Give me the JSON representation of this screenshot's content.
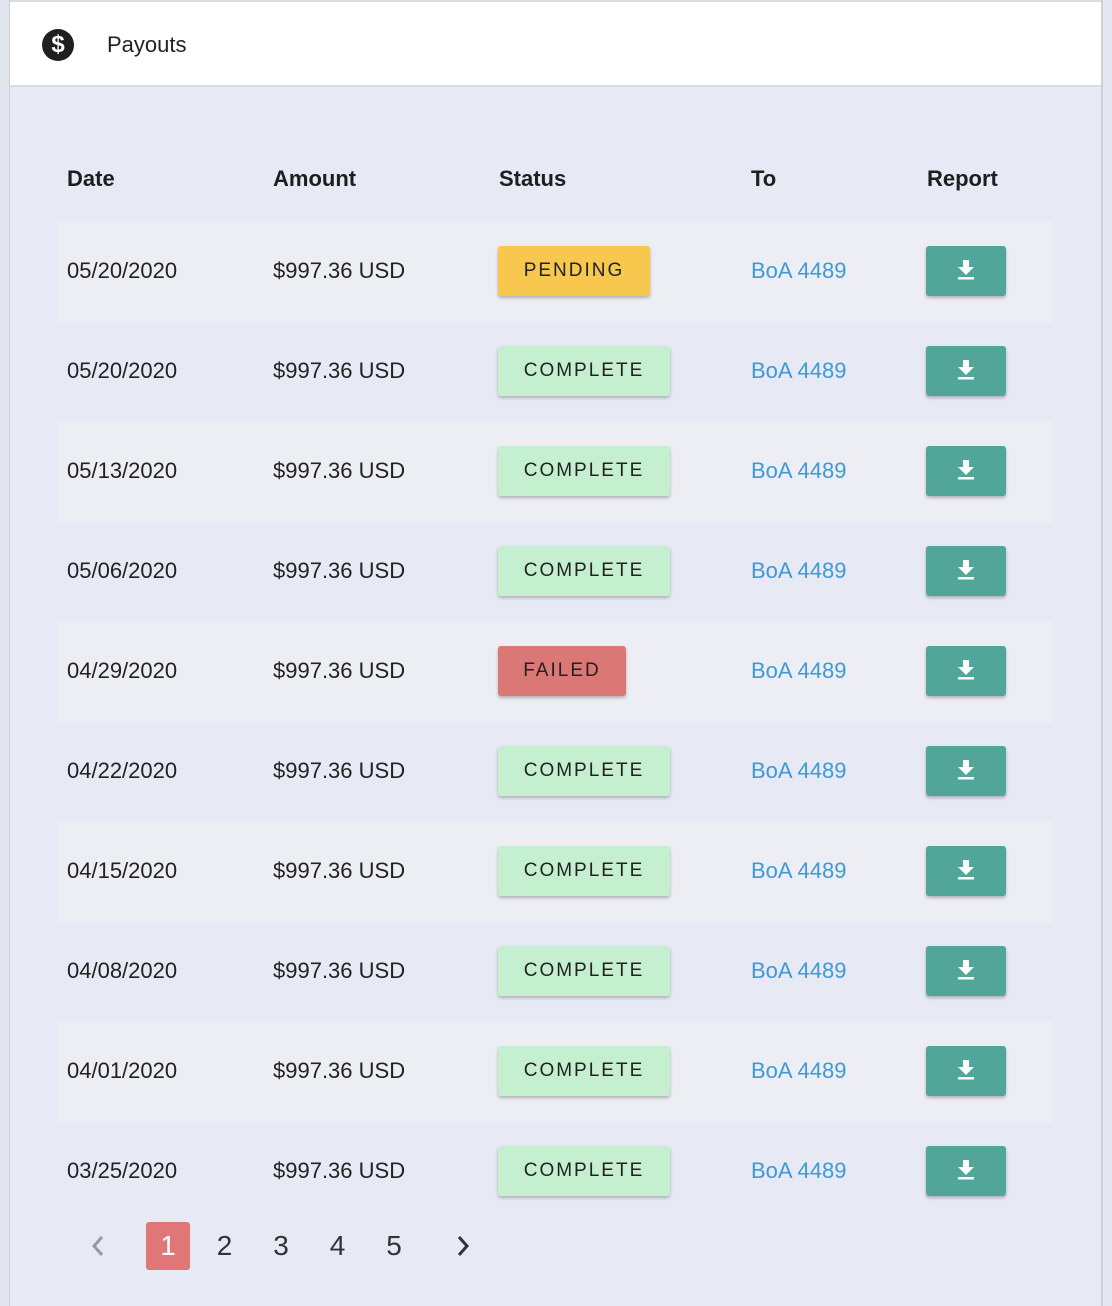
{
  "header": {
    "title": "Payouts",
    "icon": "dollar-circle-icon",
    "icon_glyph": "$"
  },
  "columns": [
    "Date",
    "Amount",
    "Status",
    "To",
    "Report"
  ],
  "status_colors": {
    "PENDING": "#f7c74e",
    "COMPLETE": "#c5f0cf",
    "FAILED": "#db7775"
  },
  "accent": {
    "download": "#52a599",
    "link": "#3d9ad6",
    "active_page": "#e07676"
  },
  "rows": [
    {
      "date": "05/20/2020",
      "amount": "$997.36 USD",
      "status": "PENDING",
      "to": "BoA 4489"
    },
    {
      "date": "05/20/2020",
      "amount": "$997.36 USD",
      "status": "COMPLETE",
      "to": "BoA 4489"
    },
    {
      "date": "05/13/2020",
      "amount": "$997.36 USD",
      "status": "COMPLETE",
      "to": "BoA 4489"
    },
    {
      "date": "05/06/2020",
      "amount": "$997.36 USD",
      "status": "COMPLETE",
      "to": "BoA 4489"
    },
    {
      "date": "04/29/2020",
      "amount": "$997.36 USD",
      "status": "FAILED",
      "to": "BoA 4489"
    },
    {
      "date": "04/22/2020",
      "amount": "$997.36 USD",
      "status": "COMPLETE",
      "to": "BoA 4489"
    },
    {
      "date": "04/15/2020",
      "amount": "$997.36 USD",
      "status": "COMPLETE",
      "to": "BoA 4489"
    },
    {
      "date": "04/08/2020",
      "amount": "$997.36 USD",
      "status": "COMPLETE",
      "to": "BoA 4489"
    },
    {
      "date": "04/01/2020",
      "amount": "$997.36 USD",
      "status": "COMPLETE",
      "to": "BoA 4489"
    },
    {
      "date": "03/25/2020",
      "amount": "$997.36 USD",
      "status": "COMPLETE",
      "to": "BoA 4489"
    }
  ],
  "pagination": {
    "pages": [
      "1",
      "2",
      "3",
      "4",
      "5"
    ],
    "current": "1",
    "prev_icon": "chevron-left-icon",
    "next_icon": "chevron-right-icon"
  }
}
